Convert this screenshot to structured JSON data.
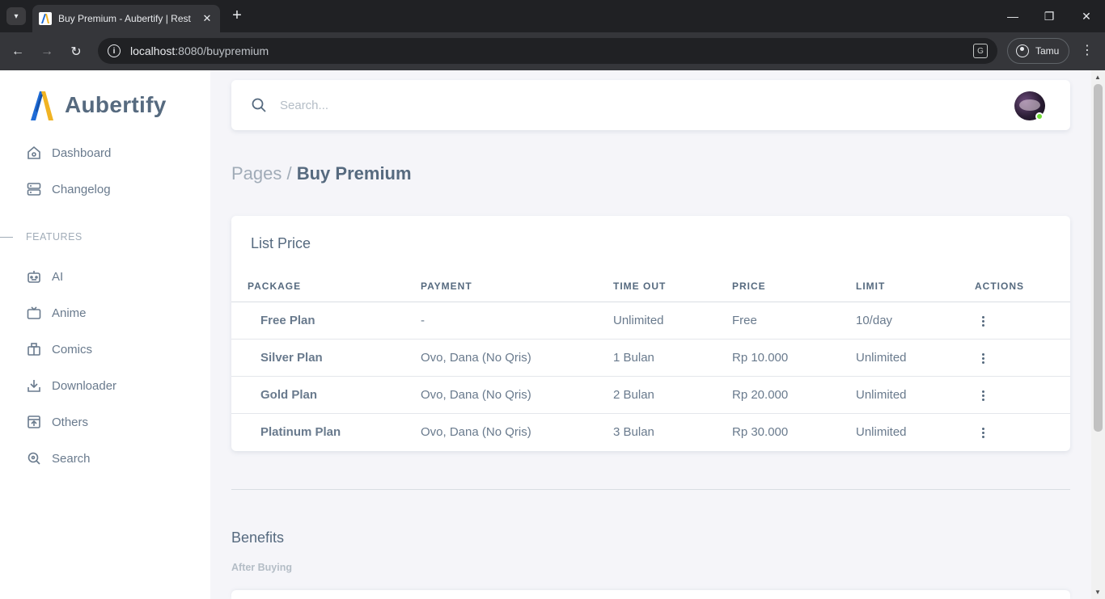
{
  "browser": {
    "tab_title": "Buy Premium - Aubertify | Rest",
    "close_tab": "✕",
    "new_tab": "+",
    "minimize": "—",
    "maximize": "❐",
    "close_window": "✕",
    "url_host": "localhost",
    "url_path": ":8080/buypremium",
    "profile_label": "Tamu",
    "menu_dots": "⋮",
    "back": "←",
    "forward": "→",
    "reload": "↻",
    "tab_list": "▾",
    "info": "i",
    "translate": "G"
  },
  "sidebar": {
    "brand": "Aubertify",
    "items_top": [
      {
        "label": "Dashboard",
        "icon": "home-icon"
      },
      {
        "label": "Changelog",
        "icon": "server-icon"
      }
    ],
    "section_label": "FEATURES",
    "items_features": [
      {
        "label": "AI",
        "icon": "bot-icon"
      },
      {
        "label": "Anime",
        "icon": "tv-icon"
      },
      {
        "label": "Comics",
        "icon": "book-icon"
      },
      {
        "label": "Downloader",
        "icon": "download-icon"
      },
      {
        "label": "Others",
        "icon": "box-icon"
      },
      {
        "label": "Search",
        "icon": "search-icon"
      }
    ]
  },
  "topbar": {
    "search_placeholder": "Search..."
  },
  "breadcrumb": {
    "parent": "Pages /",
    "current": "Buy Premium"
  },
  "price_card": {
    "title": "List Price",
    "columns": [
      "PACKAGE",
      "PAYMENT",
      "TIME OUT",
      "PRICE",
      "LIMIT",
      "ACTIONS"
    ],
    "rows": [
      {
        "package": "Free Plan",
        "payment": "-",
        "time_out": "Unlimited",
        "price": "Free",
        "limit": "10/day"
      },
      {
        "package": "Silver Plan",
        "payment": "Ovo, Dana (No Qris)",
        "time_out": "1 Bulan",
        "price": "Rp 10.000",
        "limit": "Unlimited"
      },
      {
        "package": "Gold Plan",
        "payment": "Ovo, Dana (No Qris)",
        "time_out": "2 Bulan",
        "price": "Rp 20.000",
        "limit": "Unlimited"
      },
      {
        "package": "Platinum Plan",
        "payment": "Ovo, Dana (No Qris)",
        "time_out": "3 Bulan",
        "price": "Rp 30.000",
        "limit": "Unlimited"
      }
    ]
  },
  "benefits": {
    "title": "Benefits",
    "subtitle": "After Buying"
  },
  "colors": {
    "accent": "#696cff",
    "text": "#697a8d",
    "heading": "#566a7f",
    "online": "#71dd37"
  }
}
